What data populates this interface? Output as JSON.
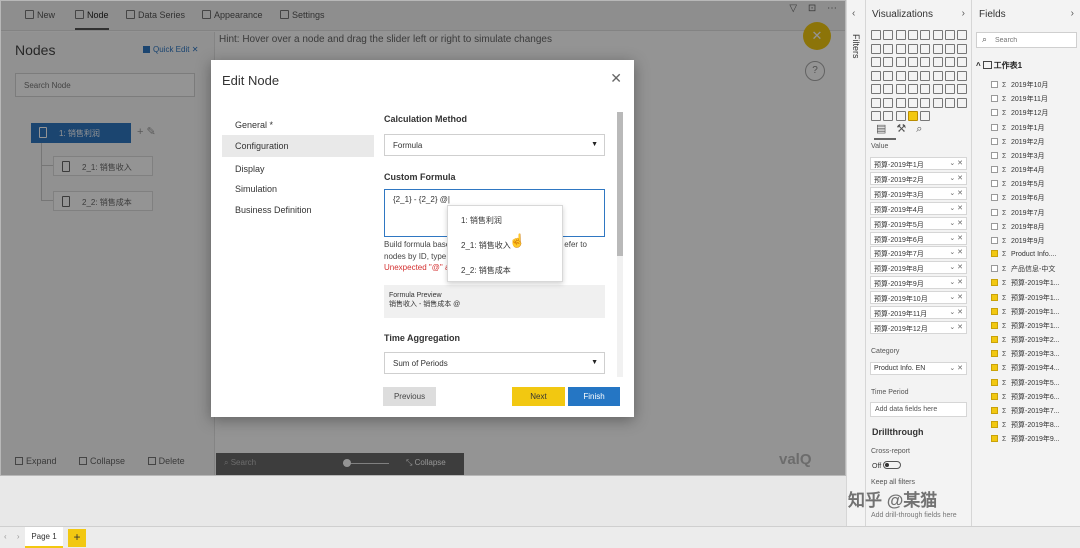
{
  "toolbar": {
    "items": [
      "New",
      "Node",
      "Data Series",
      "Appearance",
      "Settings"
    ],
    "icons": [
      "plus-icon",
      "node-icon",
      "data-series-icon",
      "appearance-icon",
      "gear-icon"
    ]
  },
  "nodes_panel": {
    "title": "Nodes",
    "quick_edit": "Quick Edit",
    "search_placeholder": "Search Node",
    "tree": {
      "root": "1: 销售利润",
      "children": [
        "2_1: 销售收入",
        "2_2: 销售成本"
      ]
    },
    "actions": [
      "Expand",
      "Collapse",
      "Delete"
    ]
  },
  "hint": "Hint: Hover over a node and drag the slider left or right to simulate changes",
  "slider": {
    "search_label": "Search",
    "collapse_label": "Collapse"
  },
  "brand_logo": "valQ",
  "dialog": {
    "title": "Edit Node",
    "nav": [
      "General *",
      "Configuration",
      "Display",
      "Simulation",
      "Business Definition"
    ],
    "active_nav": "Configuration",
    "calculation_method_label": "Calculation Method",
    "calculation_method_value": "Formula",
    "custom_formula_label": "Custom Formula",
    "formula_value": "{2_1} - {2_2} @|",
    "formula_help_line1": "Build formula base",
    "formula_help_line1_end": "efer to",
    "formula_help_line2": "nodes by ID, type",
    "formula_error": "Unexpected \"@\" a",
    "preview_title": "Formula Preview",
    "preview_value": "销售收入 - 销售成本 @",
    "time_aggregation_label": "Time Aggregation",
    "time_aggregation_value": "Sum of Periods",
    "autocomplete": [
      "1: 销售利润",
      "2_1: 销售收入",
      "2_2: 销售成本"
    ],
    "buttons": {
      "previous": "Previous",
      "next": "Next",
      "finish": "Finish"
    }
  },
  "filters_label": "Filters",
  "visualizations": {
    "title": "Visualizations",
    "value_label": "Value",
    "value_fields": [
      "预算-2019年1月",
      "预算-2019年2月",
      "预算-2019年3月",
      "预算-2019年4月",
      "预算-2019年5月",
      "预算-2019年6月",
      "预算-2019年7月",
      "预算-2019年8月",
      "预算-2019年9月",
      "预算-2019年10月",
      "预算-2019年11月",
      "预算-2019年12月"
    ],
    "category_label": "Category",
    "category_field": "Product Info. EN",
    "time_period_label": "Time Period",
    "time_period_placeholder": "Add data fields here",
    "drillthrough_title": "Drillthrough",
    "cross_report_label": "Cross-report",
    "cross_report_state": "Off",
    "keep_filters_label": "Keep all filters",
    "drill_hint": "Add drill-through fields here"
  },
  "fields": {
    "title": "Fields",
    "search_placeholder": "Search",
    "table_name": "工作表1",
    "items": [
      {
        "label": "2019年10月",
        "checked": false
      },
      {
        "label": "2019年11月",
        "checked": false
      },
      {
        "label": "2019年12月",
        "checked": false
      },
      {
        "label": "2019年1月",
        "checked": false
      },
      {
        "label": "2019年2月",
        "checked": false
      },
      {
        "label": "2019年3月",
        "checked": false
      },
      {
        "label": "2019年4月",
        "checked": false
      },
      {
        "label": "2019年5月",
        "checked": false
      },
      {
        "label": "2019年6月",
        "checked": false
      },
      {
        "label": "2019年7月",
        "checked": false
      },
      {
        "label": "2019年8月",
        "checked": false
      },
      {
        "label": "2019年9月",
        "checked": false
      },
      {
        "label": "Product Info....",
        "checked": true
      },
      {
        "label": "产品信息-中文",
        "checked": false
      },
      {
        "label": "预算-2019年1...",
        "checked": true
      },
      {
        "label": "预算-2019年1...",
        "checked": true
      },
      {
        "label": "预算-2019年1...",
        "checked": true
      },
      {
        "label": "预算-2019年1...",
        "checked": true
      },
      {
        "label": "预算-2019年2...",
        "checked": true
      },
      {
        "label": "预算-2019年3...",
        "checked": true
      },
      {
        "label": "预算-2019年4...",
        "checked": true
      },
      {
        "label": "预算-2019年5...",
        "checked": true
      },
      {
        "label": "预算-2019年6...",
        "checked": true
      },
      {
        "label": "预算-2019年7...",
        "checked": true
      },
      {
        "label": "预算-2019年8...",
        "checked": true
      },
      {
        "label": "预算-2019年9...",
        "checked": true
      }
    ]
  },
  "pages": {
    "tabs": [
      "Page 1"
    ],
    "add_label": "+"
  },
  "watermark": "知乎 @某猫",
  "colors": {
    "accent_yellow": "#f2c811",
    "accent_blue": "#2576c4",
    "error_red": "#d32f2f"
  }
}
